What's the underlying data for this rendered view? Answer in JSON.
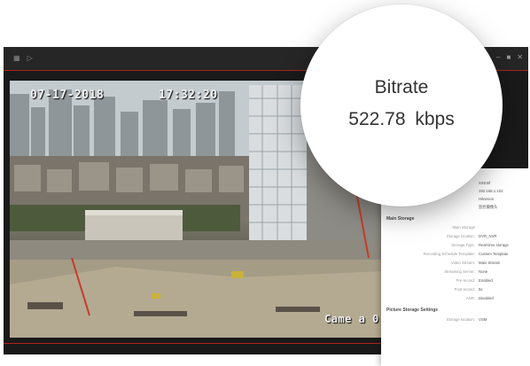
{
  "video": {
    "osd_date": "07-17-2018",
    "osd_time": "17:32:20",
    "osd_camera": "Came a 0"
  },
  "window_controls": {
    "minimize": "–",
    "maximize": "■",
    "close": "✕"
  },
  "icons": {
    "left_1": "grid-icon",
    "left_2": "play-icon",
    "right_1": "home-icon"
  },
  "magnifier": {
    "label": "Bitrate",
    "value": "522.78 kbps"
  },
  "info_panel": {
    "partial_rows": [
      {
        "value": "Xrt8.Bf"
      },
      {
        "value": "192.168.1.102"
      },
      {
        "value": "Hikvision"
      },
      {
        "value": "监控摄像头"
      }
    ],
    "main_storage_section": "Main Storage",
    "main_storage_rows": [
      {
        "label": "Main Storage",
        "value": ""
      },
      {
        "label": "Storage location:",
        "value": "DVR_NVR"
      },
      {
        "label": "Storage Type:",
        "value": "Real-time storage"
      },
      {
        "label": "Recording Schedule Template:",
        "value": "Custom Template"
      },
      {
        "label": "Video Stream:",
        "value": "Main Stream"
      },
      {
        "label": "Streaming Server:",
        "value": "None"
      },
      {
        "label": "Pre-record:",
        "value": "Enabled"
      },
      {
        "label": "Post-record:",
        "value": "5s"
      },
      {
        "label": "ANR:",
        "value": "Disabled"
      }
    ],
    "picture_section": "Picture Storage Settings",
    "picture_rows": [
      {
        "label": "Storage location:",
        "value": "VSM"
      }
    ]
  }
}
